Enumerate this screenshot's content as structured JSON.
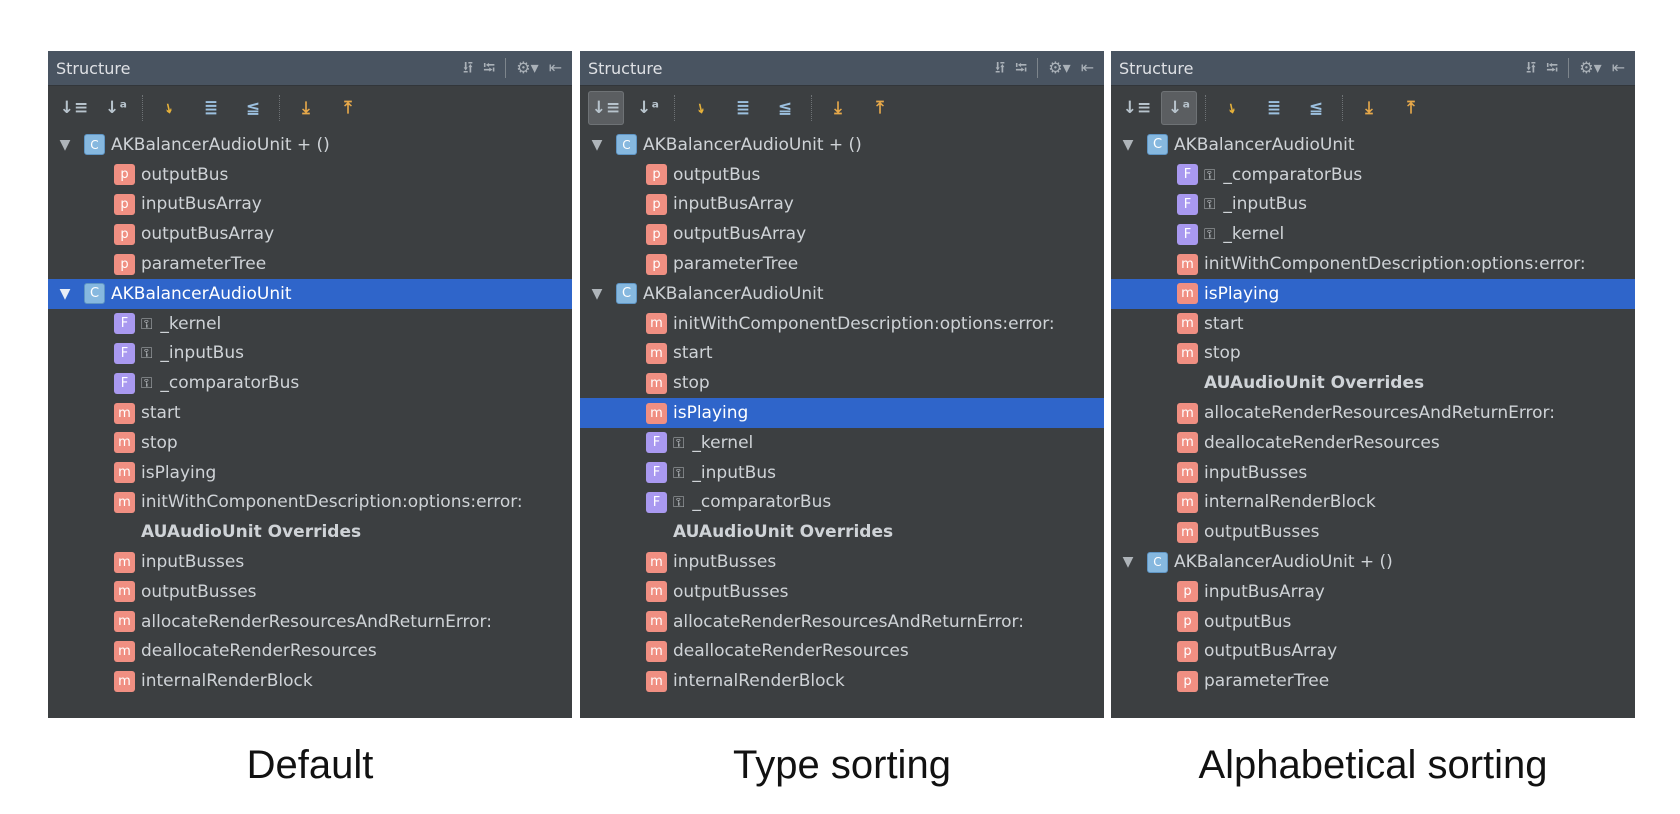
{
  "panel_title": "Structure",
  "panels": [
    {
      "caption": "Default",
      "active_sort": "none",
      "rows": [
        {
          "text": "AKBalancerAudioUnit + ()",
          "kind": "category",
          "level": 0,
          "selected": false
        },
        {
          "text": "outputBus",
          "kind": "property",
          "level": 1,
          "selected": false
        },
        {
          "text": "inputBusArray",
          "kind": "property",
          "level": 1,
          "selected": false
        },
        {
          "text": "outputBusArray",
          "kind": "property",
          "level": 1,
          "selected": false
        },
        {
          "text": "parameterTree",
          "kind": "property",
          "level": 1,
          "selected": false
        },
        {
          "text": "AKBalancerAudioUnit",
          "kind": "class",
          "level": 0,
          "selected": true
        },
        {
          "text": "_kernel",
          "kind": "field",
          "level": 1,
          "selected": false
        },
        {
          "text": "_inputBus",
          "kind": "field",
          "level": 1,
          "selected": false
        },
        {
          "text": "_comparatorBus",
          "kind": "field",
          "level": 1,
          "selected": false
        },
        {
          "text": "start",
          "kind": "method",
          "level": 1,
          "selected": false
        },
        {
          "text": "stop",
          "kind": "method",
          "level": 1,
          "selected": false
        },
        {
          "text": "isPlaying",
          "kind": "method",
          "level": 1,
          "selected": false
        },
        {
          "text": "initWithComponentDescription:options:error:",
          "kind": "method",
          "level": 1,
          "selected": false
        },
        {
          "text": "AUAudioUnit Overrides",
          "kind": "section",
          "level": 1,
          "selected": false
        },
        {
          "text": "inputBusses",
          "kind": "method",
          "level": 1,
          "selected": false
        },
        {
          "text": "outputBusses",
          "kind": "method",
          "level": 1,
          "selected": false
        },
        {
          "text": "allocateRenderResourcesAndReturnError:",
          "kind": "method",
          "level": 1,
          "selected": false
        },
        {
          "text": "deallocateRenderResources",
          "kind": "method",
          "level": 1,
          "selected": false
        },
        {
          "text": "internalRenderBlock",
          "kind": "method",
          "level": 1,
          "selected": false
        }
      ]
    },
    {
      "caption": "Type sorting",
      "active_sort": "type",
      "rows": [
        {
          "text": "AKBalancerAudioUnit + ()",
          "kind": "category",
          "level": 0,
          "selected": false
        },
        {
          "text": "outputBus",
          "kind": "property",
          "level": 1,
          "selected": false
        },
        {
          "text": "inputBusArray",
          "kind": "property",
          "level": 1,
          "selected": false
        },
        {
          "text": "outputBusArray",
          "kind": "property",
          "level": 1,
          "selected": false
        },
        {
          "text": "parameterTree",
          "kind": "property",
          "level": 1,
          "selected": false
        },
        {
          "text": "AKBalancerAudioUnit",
          "kind": "class",
          "level": 0,
          "selected": false
        },
        {
          "text": "initWithComponentDescription:options:error:",
          "kind": "method",
          "level": 1,
          "selected": false
        },
        {
          "text": "start",
          "kind": "method",
          "level": 1,
          "selected": false
        },
        {
          "text": "stop",
          "kind": "method",
          "level": 1,
          "selected": false
        },
        {
          "text": "isPlaying",
          "kind": "method",
          "level": 1,
          "selected": true
        },
        {
          "text": "_kernel",
          "kind": "field",
          "level": 1,
          "selected": false
        },
        {
          "text": "_inputBus",
          "kind": "field",
          "level": 1,
          "selected": false
        },
        {
          "text": "_comparatorBus",
          "kind": "field",
          "level": 1,
          "selected": false
        },
        {
          "text": "AUAudioUnit Overrides",
          "kind": "section",
          "level": 1,
          "selected": false
        },
        {
          "text": "inputBusses",
          "kind": "method",
          "level": 1,
          "selected": false
        },
        {
          "text": "outputBusses",
          "kind": "method",
          "level": 1,
          "selected": false
        },
        {
          "text": "allocateRenderResourcesAndReturnError:",
          "kind": "method",
          "level": 1,
          "selected": false
        },
        {
          "text": "deallocateRenderResources",
          "kind": "method",
          "level": 1,
          "selected": false
        },
        {
          "text": "internalRenderBlock",
          "kind": "method",
          "level": 1,
          "selected": false
        }
      ]
    },
    {
      "caption": "Alphabetical sorting",
      "active_sort": "alpha",
      "rows": [
        {
          "text": "AKBalancerAudioUnit",
          "kind": "class",
          "level": 0,
          "selected": false
        },
        {
          "text": "_comparatorBus",
          "kind": "field",
          "level": 1,
          "selected": false
        },
        {
          "text": "_inputBus",
          "kind": "field",
          "level": 1,
          "selected": false
        },
        {
          "text": "_kernel",
          "kind": "field",
          "level": 1,
          "selected": false
        },
        {
          "text": "initWithComponentDescription:options:error:",
          "kind": "method",
          "level": 1,
          "selected": false
        },
        {
          "text": "isPlaying",
          "kind": "method",
          "level": 1,
          "selected": true
        },
        {
          "text": "start",
          "kind": "method",
          "level": 1,
          "selected": false
        },
        {
          "text": "stop",
          "kind": "method",
          "level": 1,
          "selected": false
        },
        {
          "text": "AUAudioUnit Overrides",
          "kind": "section",
          "level": 1,
          "selected": false
        },
        {
          "text": "allocateRenderResourcesAndReturnError:",
          "kind": "method",
          "level": 1,
          "selected": false
        },
        {
          "text": "deallocateRenderResources",
          "kind": "method",
          "level": 1,
          "selected": false
        },
        {
          "text": "inputBusses",
          "kind": "method",
          "level": 1,
          "selected": false
        },
        {
          "text": "internalRenderBlock",
          "kind": "method",
          "level": 1,
          "selected": false
        },
        {
          "text": "outputBusses",
          "kind": "method",
          "level": 1,
          "selected": false
        },
        {
          "text": "AKBalancerAudioUnit + ()",
          "kind": "category",
          "level": 0,
          "selected": false
        },
        {
          "text": "inputBusArray",
          "kind": "property",
          "level": 1,
          "selected": false
        },
        {
          "text": "outputBus",
          "kind": "property",
          "level": 1,
          "selected": false
        },
        {
          "text": "outputBusArray",
          "kind": "property",
          "level": 1,
          "selected": false
        },
        {
          "text": "parameterTree",
          "kind": "property",
          "level": 1,
          "selected": false
        }
      ]
    }
  ],
  "badges": {
    "class": "C",
    "category": "C",
    "property": "p",
    "method": "m",
    "field": "F"
  },
  "colors": {
    "panel_bg": "#3c3f41",
    "titlebar_bg": "#495461",
    "selection": "#2f65ca",
    "method_badge": "#f08f82",
    "field_badge": "#a999f0",
    "class_badge": "#86b8df"
  },
  "icons": {
    "titlebar": [
      "expand-all-icon",
      "collapse-all-icon",
      "gear-icon",
      "hide-icon"
    ],
    "toolbar": [
      "sort-by-type-icon",
      "sort-alphabetically-icon",
      "show-inherited-icon",
      "expand-icon",
      "collapse-icon",
      "autoscroll-to-source-icon",
      "autoscroll-from-source-icon"
    ]
  }
}
